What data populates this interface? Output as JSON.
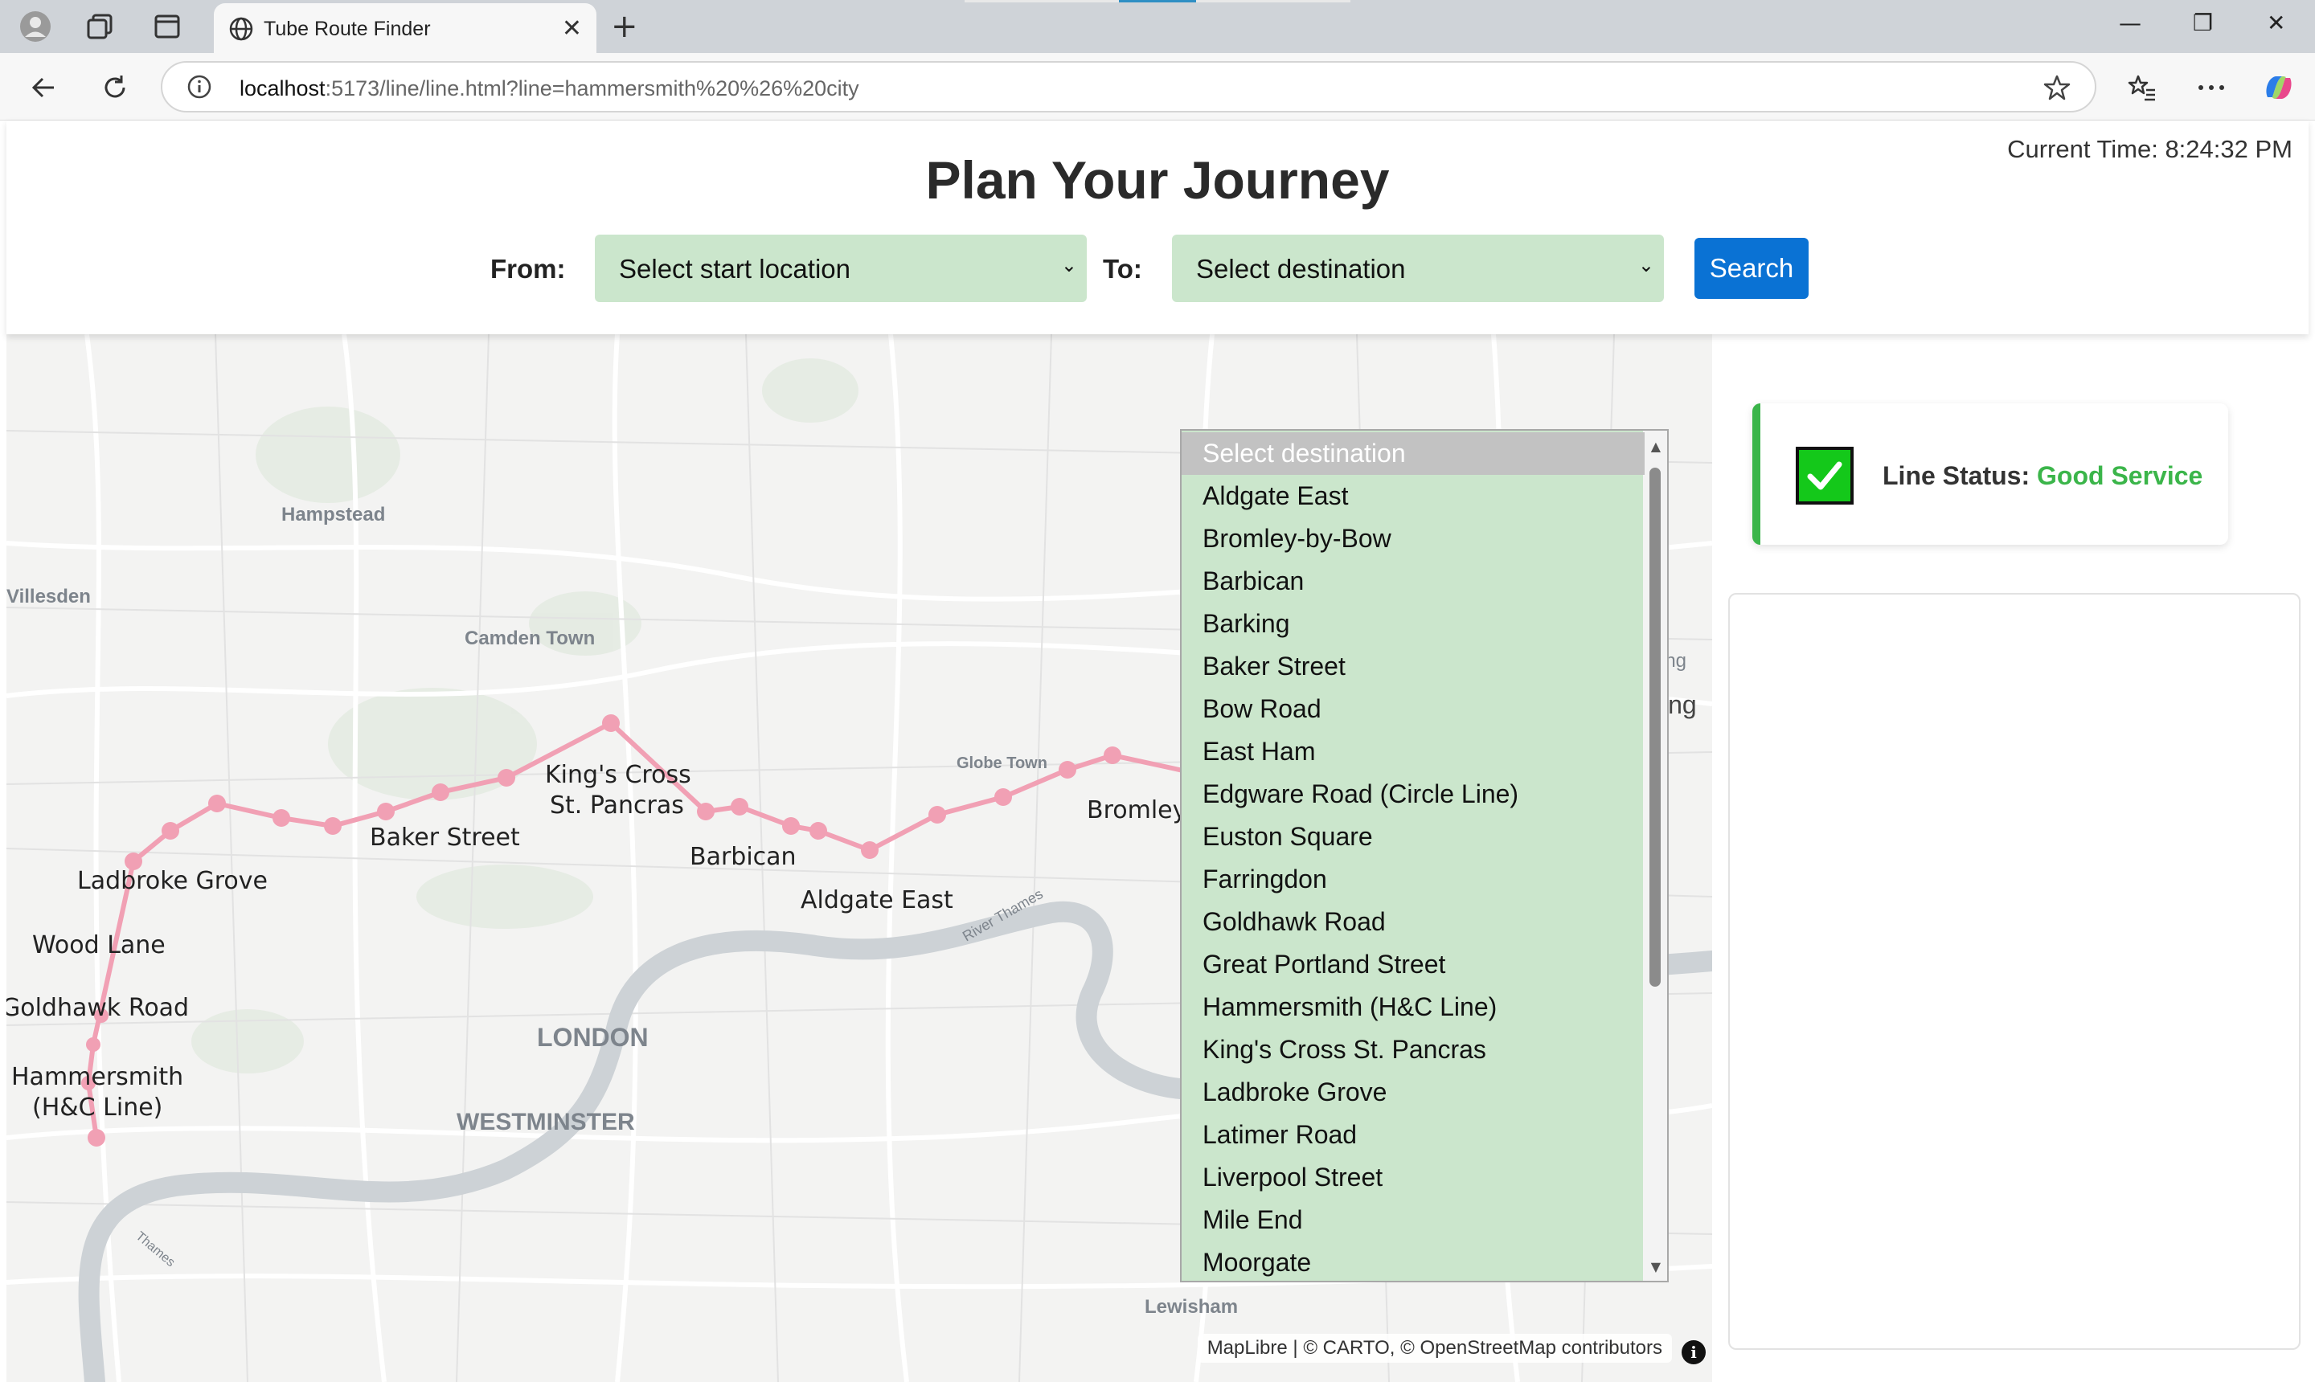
{
  "browser": {
    "tab_title": "Tube Route Finder",
    "url_host": "localhost",
    "url_rest": ":5173/line/line.html?line=hammersmith%20%26%20city"
  },
  "header": {
    "current_time": "Current Time: 8:24:32 PM",
    "title": "Plan Your Journey",
    "from_label": "From:",
    "to_label": "To:",
    "from_value": "Select start location",
    "to_value": "Select destination",
    "search_label": "Search"
  },
  "dropdown": {
    "options": [
      "Select destination",
      "Aldgate East",
      "Bromley-by-Bow",
      "Barbican",
      "Barking",
      "Baker Street",
      "Bow Road",
      "East Ham",
      "Edgware Road (Circle Line)",
      "Euston Square",
      "Farringdon",
      "Goldhawk Road",
      "Great Portland Street",
      "Hammersmith (H&C Line)",
      "King's Cross St. Pancras",
      "Ladbroke Grove",
      "Latimer Road",
      "Liverpool Street",
      "Mile End",
      "Moorgate"
    ]
  },
  "status": {
    "label": "Line Status:",
    "value": "Good Service",
    "color": "#3bb54a"
  },
  "map": {
    "line_color": "#f1a0b4",
    "areas": [
      "Hampstead",
      "Villesden",
      "Camden Town",
      "Globe Town",
      "LONDON",
      "WESTMINSTER",
      "Lewisham"
    ],
    "station_labels": [
      "King's Cross",
      "St. Pancras",
      "Baker Street",
      "Barbican",
      "Aldgate East",
      "Bromley",
      "Ladbroke Grove",
      "Wood Lane",
      "Goldhawk Road",
      "Hammersmith",
      "(H&C Line)"
    ],
    "edge_labels": [
      "ing",
      "ing"
    ],
    "river_labels": [
      "River Thames",
      "Thames"
    ],
    "attribution_lib": "MapLibre",
    "attribution_carto": "| © CARTO, ©",
    "attribution_osm": "OpenStreetMap",
    "attribution_contrib": "contributors"
  }
}
